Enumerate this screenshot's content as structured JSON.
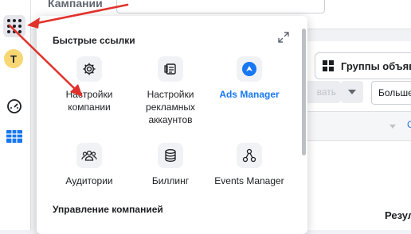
{
  "topbar": {
    "title": "Кампании",
    "field_text": ""
  },
  "rail": {
    "items": [
      {
        "name": "grid-icon"
      },
      {
        "name": "avatar",
        "letter": "T"
      },
      {
        "name": "gauge-icon"
      },
      {
        "name": "table-icon"
      }
    ]
  },
  "background": {
    "groups_tab": "Группы объяв",
    "disabled_btn": "вать",
    "more_btn": "Больше",
    "header_link": "С",
    "result_text": "Резул"
  },
  "popup": {
    "title": "Быстрые ссылки",
    "quick_links": [
      {
        "label": "Настройки компании",
        "icon": "gear-icon"
      },
      {
        "label": "Настройки рекламных аккаунтов",
        "icon": "accounts-icon"
      },
      {
        "label": "Ads Manager",
        "icon": "ads-manager-icon",
        "accent": "#1877f2"
      },
      {
        "label": "Аудитории",
        "icon": "audience-icon"
      },
      {
        "label": "Биллинг",
        "icon": "billing-icon"
      },
      {
        "label": "Events Manager",
        "icon": "events-manager-icon"
      }
    ],
    "section_title": "Управление компанией"
  },
  "colors": {
    "accent": "#1877f2",
    "annotation": "#e0322b"
  }
}
